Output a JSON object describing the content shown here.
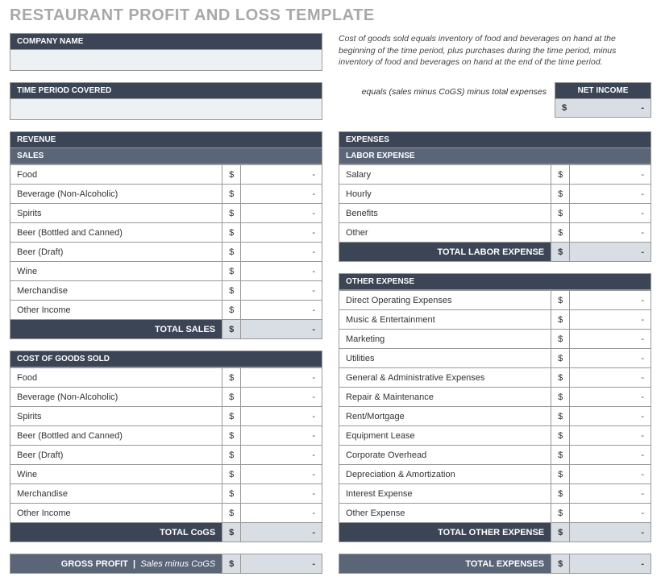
{
  "title": "RESTAURANT PROFIT AND LOSS TEMPLATE",
  "company_name_label": "COMPANY NAME",
  "time_period_label": "TIME PERIOD COVERED",
  "cogs_note": "Cost of goods sold equals inventory of food and beverages on hand at the beginning of the time period, plus purchases during the time period, minus inventory of food and beverages on hand at the end of the time period.",
  "net_income": {
    "label": "NET INCOME",
    "note": "equals (sales minus CoGS) minus total expenses",
    "currency": "$",
    "value": "-"
  },
  "revenue": {
    "header": "REVENUE",
    "sales_header": "SALES",
    "items": [
      {
        "label": "Food",
        "cur": "$",
        "amt": "-"
      },
      {
        "label": "Beverage (Non-Alcoholic)",
        "cur": "$",
        "amt": "-"
      },
      {
        "label": "Spirits",
        "cur": "$",
        "amt": "-"
      },
      {
        "label": "Beer (Bottled and Canned)",
        "cur": "$",
        "amt": "-"
      },
      {
        "label": "Beer (Draft)",
        "cur": "$",
        "amt": "-"
      },
      {
        "label": "Wine",
        "cur": "$",
        "amt": "-"
      },
      {
        "label": "Merchandise",
        "cur": "$",
        "amt": "-"
      },
      {
        "label": "Other  Income",
        "cur": "$",
        "amt": "-"
      }
    ],
    "total": {
      "label": "TOTAL SALES",
      "cur": "$",
      "amt": "-"
    }
  },
  "cogs": {
    "header": "COST OF GOODS SOLD",
    "items": [
      {
        "label": "Food",
        "cur": "$",
        "amt": "-"
      },
      {
        "label": "Beverage (Non-Alcoholic)",
        "cur": "$",
        "amt": "-"
      },
      {
        "label": "Spirits",
        "cur": "$",
        "amt": "-"
      },
      {
        "label": "Beer (Bottled and Canned)",
        "cur": "$",
        "amt": "-"
      },
      {
        "label": "Beer (Draft)",
        "cur": "$",
        "amt": "-"
      },
      {
        "label": "Wine",
        "cur": "$",
        "amt": "-"
      },
      {
        "label": "Merchandise",
        "cur": "$",
        "amt": "-"
      },
      {
        "label": "Other  Income",
        "cur": "$",
        "amt": "-"
      }
    ],
    "total": {
      "label": "TOTAL CoGS",
      "cur": "$",
      "amt": "-"
    }
  },
  "gross_profit": {
    "label": "GROSS PROFIT",
    "sub": "Sales minus CoGS",
    "cur": "$",
    "amt": "-"
  },
  "expenses": {
    "header": "EXPENSES",
    "labor_header": "LABOR EXPENSE",
    "labor_items": [
      {
        "label": "Salary",
        "cur": "$",
        "amt": "-"
      },
      {
        "label": "Hourly",
        "cur": "$",
        "amt": "-"
      },
      {
        "label": "Benefits",
        "cur": "$",
        "amt": "-"
      },
      {
        "label": "Other",
        "cur": "$",
        "amt": "-"
      }
    ],
    "labor_total": {
      "label": "TOTAL LABOR EXPENSE",
      "cur": "$",
      "amt": "-"
    },
    "other_header": "OTHER EXPENSE",
    "other_items": [
      {
        "label": "Direct Operating Expenses",
        "cur": "$",
        "amt": "-"
      },
      {
        "label": "Music & Entertainment",
        "cur": "$",
        "amt": "-"
      },
      {
        "label": "Marketing",
        "cur": "$",
        "amt": "-"
      },
      {
        "label": "Utilities",
        "cur": "$",
        "amt": "-"
      },
      {
        "label": "General & Administrative Expenses",
        "cur": "$",
        "amt": "-"
      },
      {
        "label": "Repair & Maintenance",
        "cur": "$",
        "amt": "-"
      },
      {
        "label": "Rent/Mortgage",
        "cur": "$",
        "amt": "-"
      },
      {
        "label": "Equipment Lease",
        "cur": "$",
        "amt": "-"
      },
      {
        "label": "Corporate Overhead",
        "cur": "$",
        "amt": "-"
      },
      {
        "label": "Depreciation & Amortization",
        "cur": "$",
        "amt": "-"
      },
      {
        "label": "Interest Expense",
        "cur": "$",
        "amt": "-"
      },
      {
        "label": "Other Expense",
        "cur": "$",
        "amt": "-"
      }
    ],
    "other_total": {
      "label": "TOTAL OTHER EXPENSE",
      "cur": "$",
      "amt": "-"
    },
    "total": {
      "label": "TOTAL EXPENSES",
      "cur": "$",
      "amt": "-"
    }
  }
}
